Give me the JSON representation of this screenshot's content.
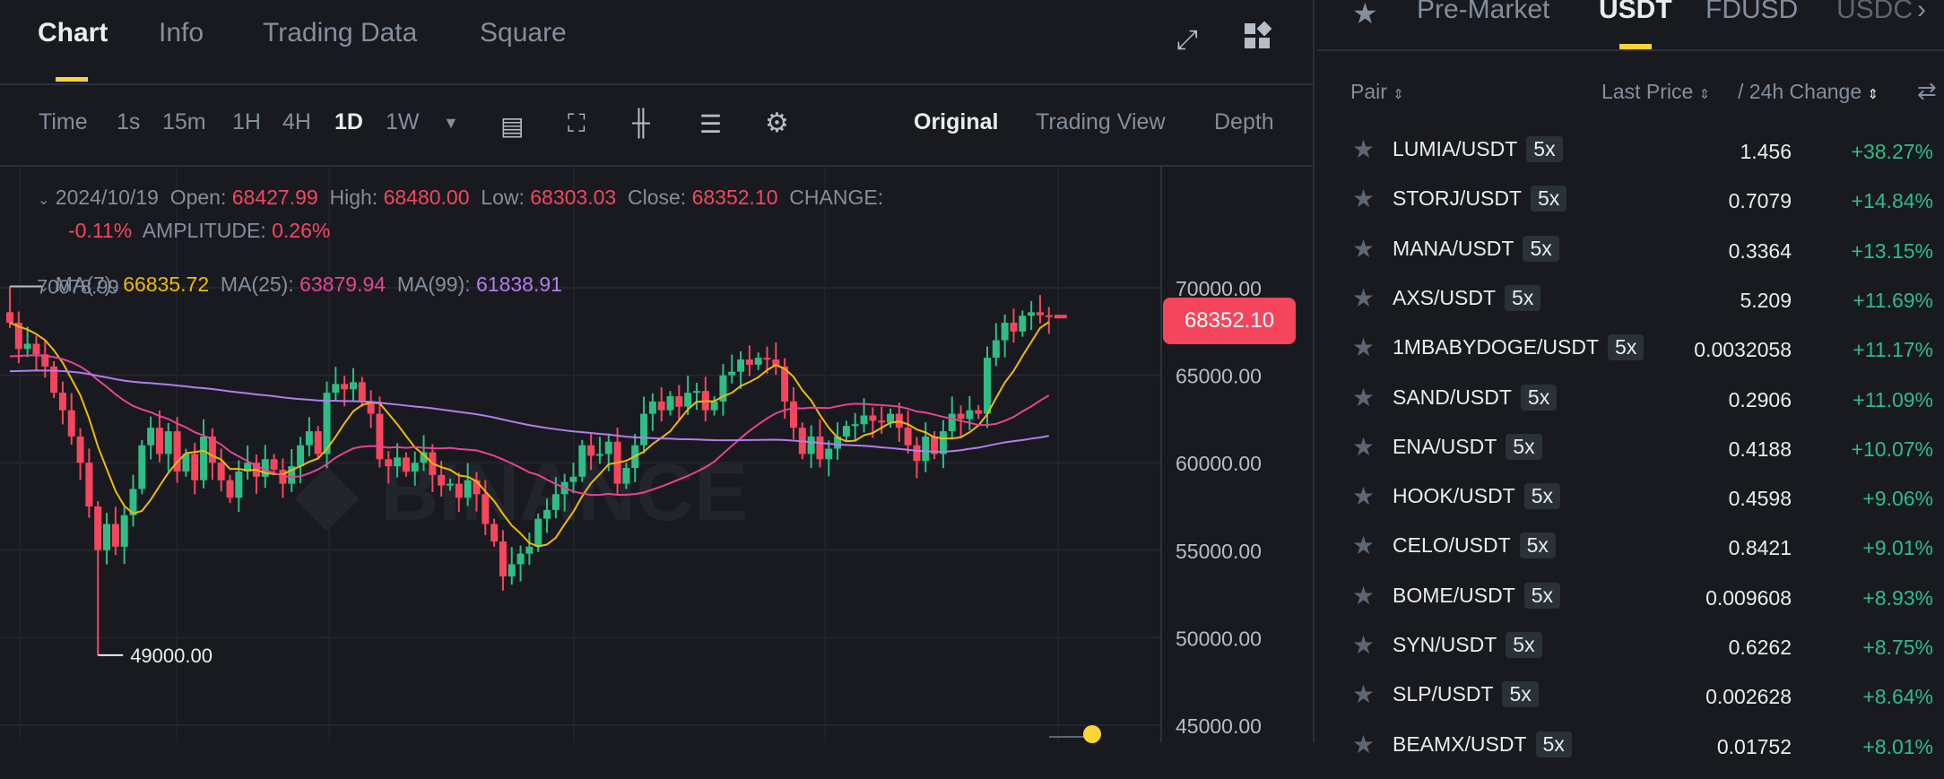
{
  "top_tabs": [
    "Chart",
    "Info",
    "Trading Data",
    "Square"
  ],
  "toolbar": {
    "intervals": [
      "Time",
      "1s",
      "15m",
      "1H",
      "4H",
      "1D",
      "1W"
    ],
    "active_interval": "1D",
    "views": [
      "Original",
      "Trading View",
      "Depth"
    ],
    "active_view": "Original"
  },
  "ohlc": {
    "date": "2024/10/19",
    "open_label": "Open:",
    "open": "68427.99",
    "high_label": "High:",
    "high": "68480.00",
    "low_label": "Low:",
    "low": "68303.03",
    "close_label": "Close:",
    "close": "68352.10",
    "change_label": "CHANGE:",
    "change": "-0.11%",
    "amplitude_label": "AMPLITUDE:",
    "amplitude": "0.26%"
  },
  "ma": {
    "ma7_label": "MA(7):",
    "ma7": "66835.72",
    "ma25_label": "MA(25):",
    "ma25": "63879.94",
    "ma99_label": "MA(99):",
    "ma99": "61838.91"
  },
  "colors": {
    "up": "#2ebd85",
    "down": "#f6465d",
    "ma7": "#f0b90b",
    "ma25": "#e84393",
    "ma99": "#b57cf0",
    "accent": "#fcd535"
  },
  "chart_data": {
    "type": "candlestick",
    "y_ticks": [
      "70000.00",
      "65000.00",
      "60000.00",
      "55000.00",
      "50000.00",
      "45000.00"
    ],
    "ylim": [
      45000,
      70000
    ],
    "last_price": "68352.10",
    "max_label": "70078.99",
    "min_label": "49000.00",
    "first_open": 68600,
    "closes": [
      68000,
      66500,
      66800,
      66200,
      65500,
      64000,
      63000,
      61500,
      60000,
      57500,
      55000,
      56500,
      55200,
      57000,
      58500,
      61000,
      62000,
      60500,
      61800,
      59500,
      60500,
      59000,
      61500,
      60000,
      59000,
      58000,
      59500,
      60000,
      59200,
      60200,
      59600,
      58800,
      59800,
      61000,
      61800,
      60500,
      64000,
      64500,
      64200,
      64600,
      63500,
      62800,
      60200,
      59800,
      60300,
      59500,
      60000,
      60600,
      59300,
      58700,
      58800,
      58000,
      59000,
      58200,
      56500,
      55500,
      53500,
      54200,
      54800,
      55200,
      56800,
      57300,
      58200,
      58900,
      59200,
      61000,
      60400,
      60500,
      61200,
      58800,
      59700,
      61000,
      62800,
      63500,
      63000,
      63800,
      63200,
      64000,
      64100,
      63000,
      63500,
      65000,
      65200,
      65900,
      65600,
      66000,
      65900,
      65500,
      63500,
      62000,
      60500,
      61500,
      60200,
      60800,
      61500,
      62100,
      62200,
      62700,
      62400,
      62300,
      62800,
      62000,
      61000,
      60100,
      61500,
      60500,
      61800,
      62800,
      62500,
      63000,
      62800,
      66000,
      67000,
      68000,
      67500,
      68400,
      68600,
      68428,
      68352.1
    ]
  },
  "market": {
    "tabs": [
      "Pre-Market",
      "USDT",
      "FDUSD",
      "USDC"
    ],
    "active_tab": "USDT",
    "header": {
      "pair": "Pair",
      "last_price": "Last Price",
      "change": "/ 24h Change"
    },
    "rows": [
      {
        "pair": "LUMIA/USDT",
        "lev": "5x",
        "price": "1.456",
        "change": "+38.27%"
      },
      {
        "pair": "STORJ/USDT",
        "lev": "5x",
        "price": "0.7079",
        "change": "+14.84%"
      },
      {
        "pair": "MANA/USDT",
        "lev": "5x",
        "price": "0.3364",
        "change": "+13.15%"
      },
      {
        "pair": "AXS/USDT",
        "lev": "5x",
        "price": "5.209",
        "change": "+11.69%"
      },
      {
        "pair": "1MBABYDOGE/USDT",
        "lev": "5x",
        "price": "0.0032058",
        "change": "+11.17%"
      },
      {
        "pair": "SAND/USDT",
        "lev": "5x",
        "price": "0.2906",
        "change": "+11.09%"
      },
      {
        "pair": "ENA/USDT",
        "lev": "5x",
        "price": "0.4188",
        "change": "+10.07%"
      },
      {
        "pair": "HOOK/USDT",
        "lev": "5x",
        "price": "0.4598",
        "change": "+9.06%"
      },
      {
        "pair": "CELO/USDT",
        "lev": "5x",
        "price": "0.8421",
        "change": "+9.01%"
      },
      {
        "pair": "BOME/USDT",
        "lev": "5x",
        "price": "0.009608",
        "change": "+8.93%"
      },
      {
        "pair": "SYN/USDT",
        "lev": "5x",
        "price": "0.6262",
        "change": "+8.75%"
      },
      {
        "pair": "SLP/USDT",
        "lev": "5x",
        "price": "0.002628",
        "change": "+8.64%"
      },
      {
        "pair": "BEAMX/USDT",
        "lev": "5x",
        "price": "0.01752",
        "change": "+8.01%"
      }
    ]
  }
}
